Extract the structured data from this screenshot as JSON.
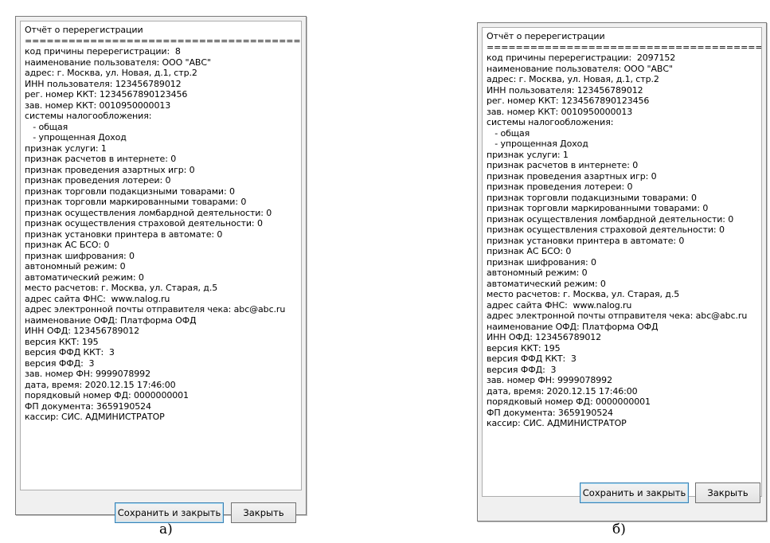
{
  "left": {
    "caption": "а)",
    "lines": [
      "Отчёт о перерегистрации",
      "==========================================",
      "код причины перерегистрации:  8",
      "наименование пользователя: ООО \"АВС\"",
      "адрес: г. Москва, ул. Новая, д.1, стр.2",
      "ИНН пользователя: 123456789012",
      "рег. номер ККТ: 1234567890123456",
      "зав. номер ККТ: 0010950000013",
      "системы налогообложения:",
      "   - общая",
      "   - упрощенная Доход",
      "признак услуги: 1",
      "признак расчетов в интернете: 0",
      "признак проведения азартных игр: 0",
      "признак проведения лотереи: 0",
      "признак торговли подакцизными товарами: 0",
      "признак торговли маркированными товарами: 0",
      "признак осуществления ломбардной деятельности: 0",
      "признак осуществления страховой деятельности: 0",
      "признак установки принтера в автомате: 0",
      "признак АС БСО: 0",
      "признак шифрования: 0",
      "автономный режим: 0",
      "автоматический режим: 0",
      "место расчетов: г. Москва, ул. Старая, д.5",
      "адрес сайта ФНС:  www.nalog.ru",
      "адрес электронной почты отправителя чека: abc@abc.ru",
      "наименование ОФД: Платформа ОФД",
      "ИНН ОФД: 123456789012",
      "версия ККТ: 195",
      "версия ФФД ККТ:  3",
      "версия ФФД:  3",
      "зав. номер ФН: 9999078992",
      "дата, время: 2020.12.15 17:46:00",
      "порядковый номер ФД: 0000000001",
      "ФП документа: 3659190524",
      "кассир: СИС. АДМИНИСТРАТОР"
    ],
    "save_label": "Сохранить и закрыть",
    "close_label": "Закрыть"
  },
  "right": {
    "caption": "б)",
    "lines": [
      "Отчёт о перерегистрации",
      "==========================================",
      "код причины перерегистрации:  2097152",
      "наименование пользователя: ООО \"АВС\"",
      "адрес: г. Москва, ул. Новая, д.1, стр.2",
      "ИНН пользователя: 123456789012",
      "рег. номер ККТ: 1234567890123456",
      "зав. номер ККТ: 0010950000013",
      "системы налогообложения:",
      "   - общая",
      "   - упрощенная Доход",
      "признак услуги: 1",
      "признак расчетов в интернете: 0",
      "признак проведения азартных игр: 0",
      "признак проведения лотереи: 0",
      "признак торговли подакцизными товарами: 0",
      "признак торговли маркированными товарами: 0",
      "признак осуществления ломбардной деятельности: 0",
      "признак осуществления страховой деятельности: 0",
      "признак установки принтера в автомате: 0",
      "признак АС БСО: 0",
      "признак шифрования: 0",
      "автономный режим: 0",
      "автоматический режим: 0",
      "место расчетов: г. Москва, ул. Старая, д.5",
      "адрес сайта ФНС:  www.nalog.ru",
      "адрес электронной почты отправителя чека: abc@abc.ru",
      "наименование ОФД: Платформа ОФД",
      "ИНН ОФД: 123456789012",
      "версия ККТ: 195",
      "версия ФФД ККТ:  3",
      "версия ФФД:  3",
      "зав. номер ФН: 9999078992",
      "дата, время: 2020.12.15 17:46:00",
      "порядковый номер ФД: 0000000001",
      "ФП документа: 3659190524",
      "кассир: СИС. АДМИНИСТРАТОР"
    ],
    "save_label": "Сохранить и закрыть",
    "close_label": "Закрыть"
  }
}
